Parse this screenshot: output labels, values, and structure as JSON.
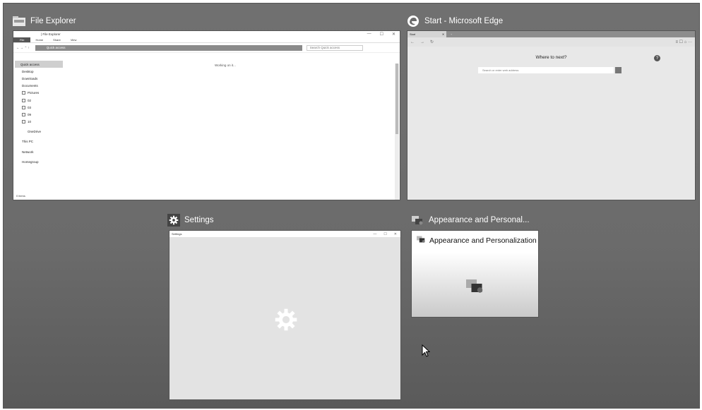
{
  "windows": [
    {
      "title": "File Explorer",
      "icon": "folder-icon"
    },
    {
      "title": "Start - Microsoft Edge",
      "icon": "edge-icon"
    },
    {
      "title": "Settings",
      "icon": "gear-icon"
    },
    {
      "title": "Appearance and Personal...",
      "icon": "appearance-icon"
    }
  ],
  "file_explorer": {
    "title": "| File Explorer",
    "ribbon": [
      "File",
      "Home",
      "Share",
      "View"
    ],
    "path": "Quick access",
    "search_placeholder": "Search Quick access",
    "nav": [
      "Quick access",
      "Desktop",
      "Downloads",
      "Documents",
      "Pictures",
      "02",
      "03",
      "09",
      "10",
      "OneDrive",
      "This PC",
      "Network",
      "Homegroup"
    ],
    "working": "Working on it...",
    "status": "0 items"
  },
  "edge": {
    "tab": "Start",
    "heading": "Where to next?",
    "search_placeholder": "Search or enter web address"
  },
  "settings": {
    "title": "Settings"
  },
  "appearance": {
    "heading": "Appearance and Personalization"
  }
}
